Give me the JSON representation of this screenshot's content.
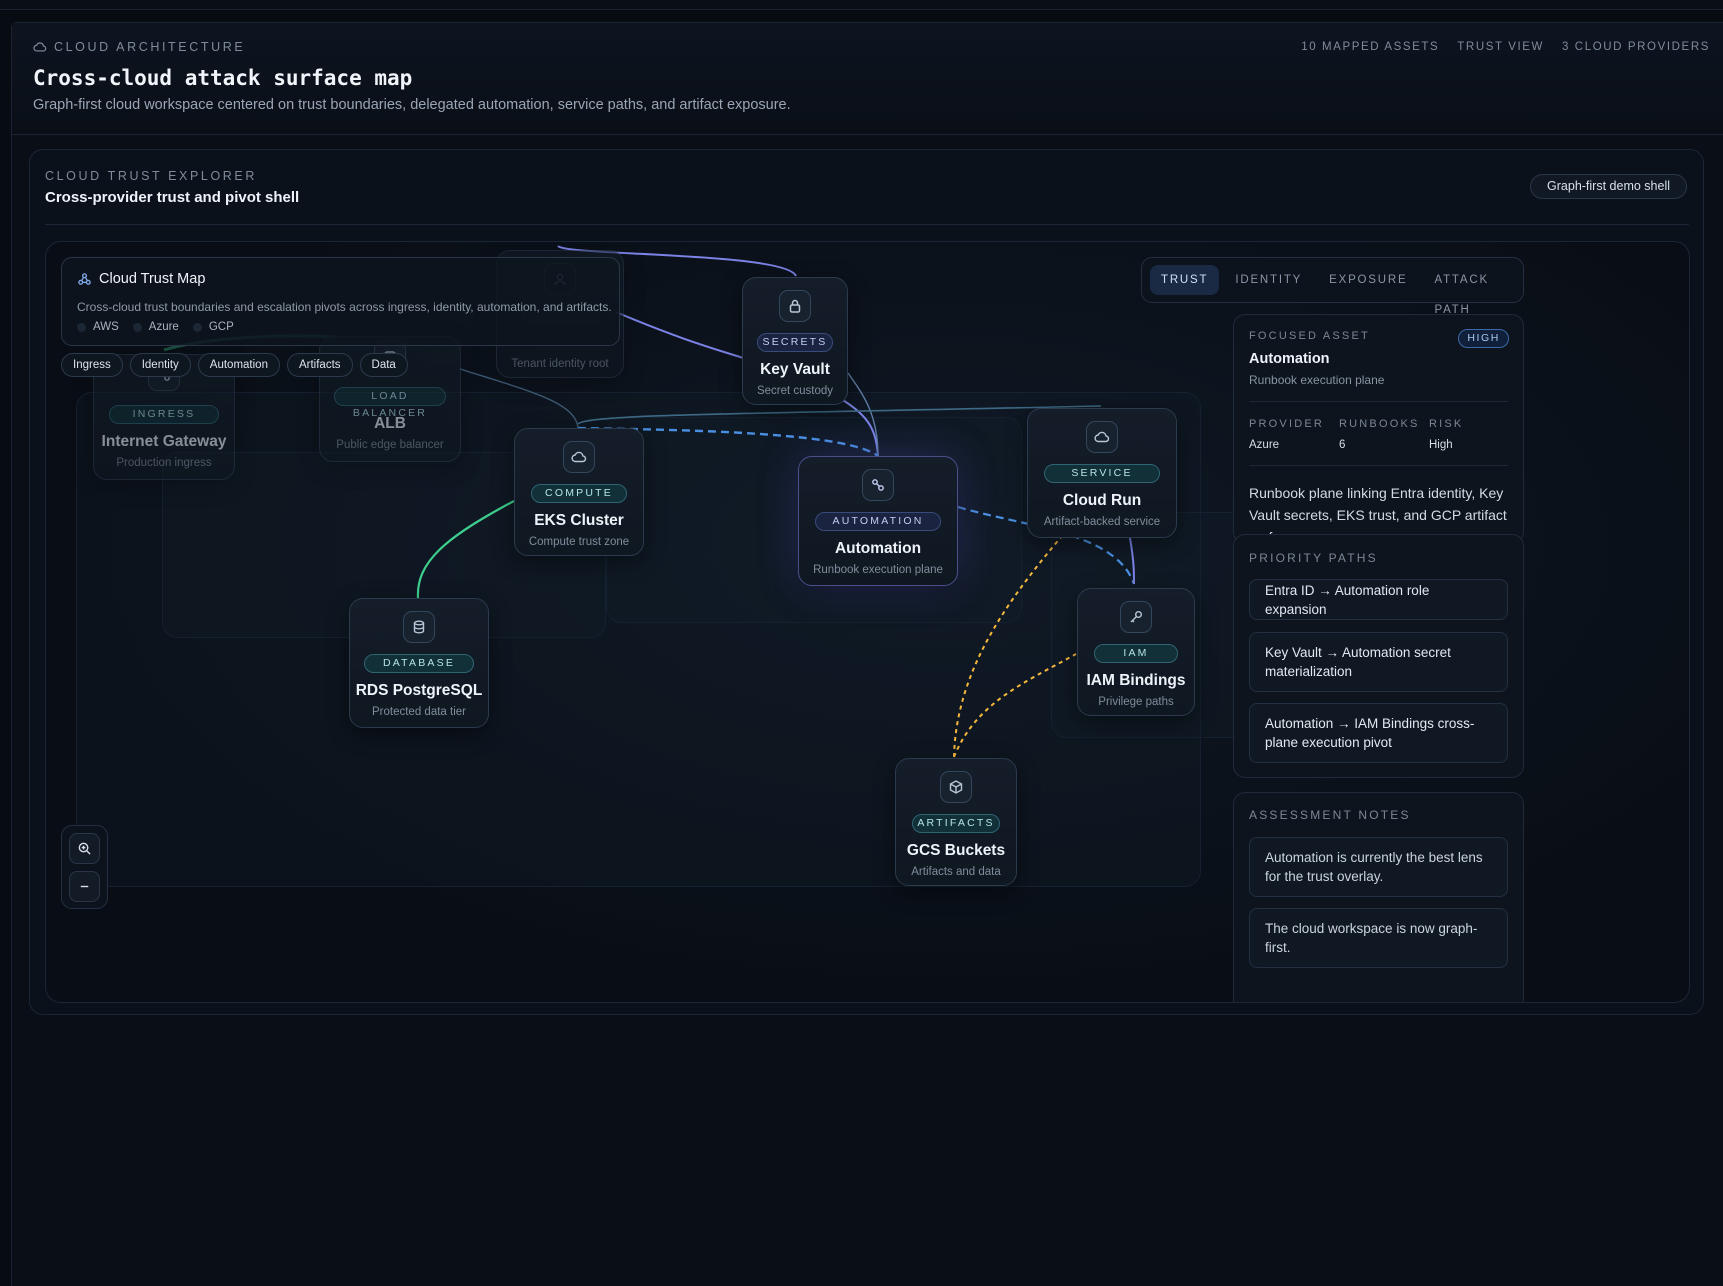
{
  "header": {
    "eyebrow": "CLOUD ARCHITECTURE",
    "title": "Cross-cloud attack surface map",
    "subtitle": "Graph-first cloud workspace centered on trust boundaries, delegated automation, service paths, and artifact exposure.",
    "meta": [
      "10 MAPPED ASSETS",
      "TRUST VIEW",
      "3 CLOUD PROVIDERS"
    ]
  },
  "panel": {
    "eyebrow": "CLOUD TRUST EXPLORER",
    "title": "Cross-provider trust and pivot shell",
    "badge": "Graph-first demo shell"
  },
  "map": {
    "title": "Cloud Trust Map",
    "description": "Cross-cloud trust boundaries and escalation pivots across ingress, identity, automation, and artifacts.",
    "legend": [
      "AWS",
      "Azure",
      "GCP"
    ],
    "filters": [
      "Ingress",
      "Identity",
      "Automation",
      "Artifacts",
      "Data"
    ],
    "tabs": [
      "TRUST",
      "IDENTITY",
      "EXPOSURE",
      "ATTACK PATH"
    ],
    "active_tab": "TRUST"
  },
  "nodes": {
    "gateway": {
      "tag": "INGRESS",
      "name": "Internet Gateway",
      "desc": "Production ingress",
      "icon": "automation-icon"
    },
    "alb": {
      "tag": "LOAD BALANCER",
      "name": "ALB",
      "desc": "Public edge balancer",
      "icon": "balancer-icon"
    },
    "entra": {
      "tag": "",
      "name": "",
      "desc": "Tenant identity root",
      "icon": "identity-icon"
    },
    "keyvault": {
      "tag": "SECRETS",
      "name": "Key Vault",
      "desc": "Secret custody",
      "icon": "lock-icon"
    },
    "eks": {
      "tag": "COMPUTE",
      "name": "EKS Cluster",
      "desc": "Compute trust zone",
      "icon": "cloud-icon"
    },
    "automation": {
      "tag": "AUTOMATION",
      "name": "Automation",
      "desc": "Runbook execution plane",
      "icon": "automation-icon"
    },
    "cloudrun": {
      "tag": "SERVICE",
      "name": "Cloud Run",
      "desc": "Artifact-backed service",
      "icon": "cloud-icon"
    },
    "rds": {
      "tag": "DATABASE",
      "name": "RDS PostgreSQL",
      "desc": "Protected data tier",
      "icon": "database-icon"
    },
    "iam": {
      "tag": "IAM",
      "name": "IAM Bindings",
      "desc": "Privilege paths",
      "icon": "key-icon"
    },
    "gcs": {
      "tag": "ARTIFACTS",
      "name": "GCS Buckets",
      "desc": "Artifacts and data",
      "icon": "box-icon"
    }
  },
  "focused": {
    "label": "FOCUSED ASSET",
    "badge": "HIGH",
    "name": "Automation",
    "sub": "Runbook execution plane",
    "stats": [
      {
        "label": "PROVIDER",
        "value": "Azure"
      },
      {
        "label": "RUNBOOKS",
        "value": "6"
      },
      {
        "label": "RISK",
        "value": "High"
      }
    ],
    "description": "Runbook plane linking Entra identity, Key Vault secrets, EKS trust, and GCP artifact surfaces."
  },
  "priority": {
    "label": "PRIORITY PATHS",
    "paths": [
      "Entra ID → Automation role expansion",
      "Key Vault → Automation secret materialization",
      "Automation → IAM Bindings cross-plane execution pivot"
    ]
  },
  "notes": {
    "label": "ASSESSMENT NOTES",
    "items": [
      "Automation is currently the best lens for the trust overlay.",
      "The cloud workspace is now graph-first."
    ]
  },
  "colors": {
    "background": "#070b12",
    "accent": "#7c83e6",
    "trust_dashed": "#4a90e2",
    "data_path": "#3ecf8e",
    "artifact_path": "#f5b83d"
  }
}
